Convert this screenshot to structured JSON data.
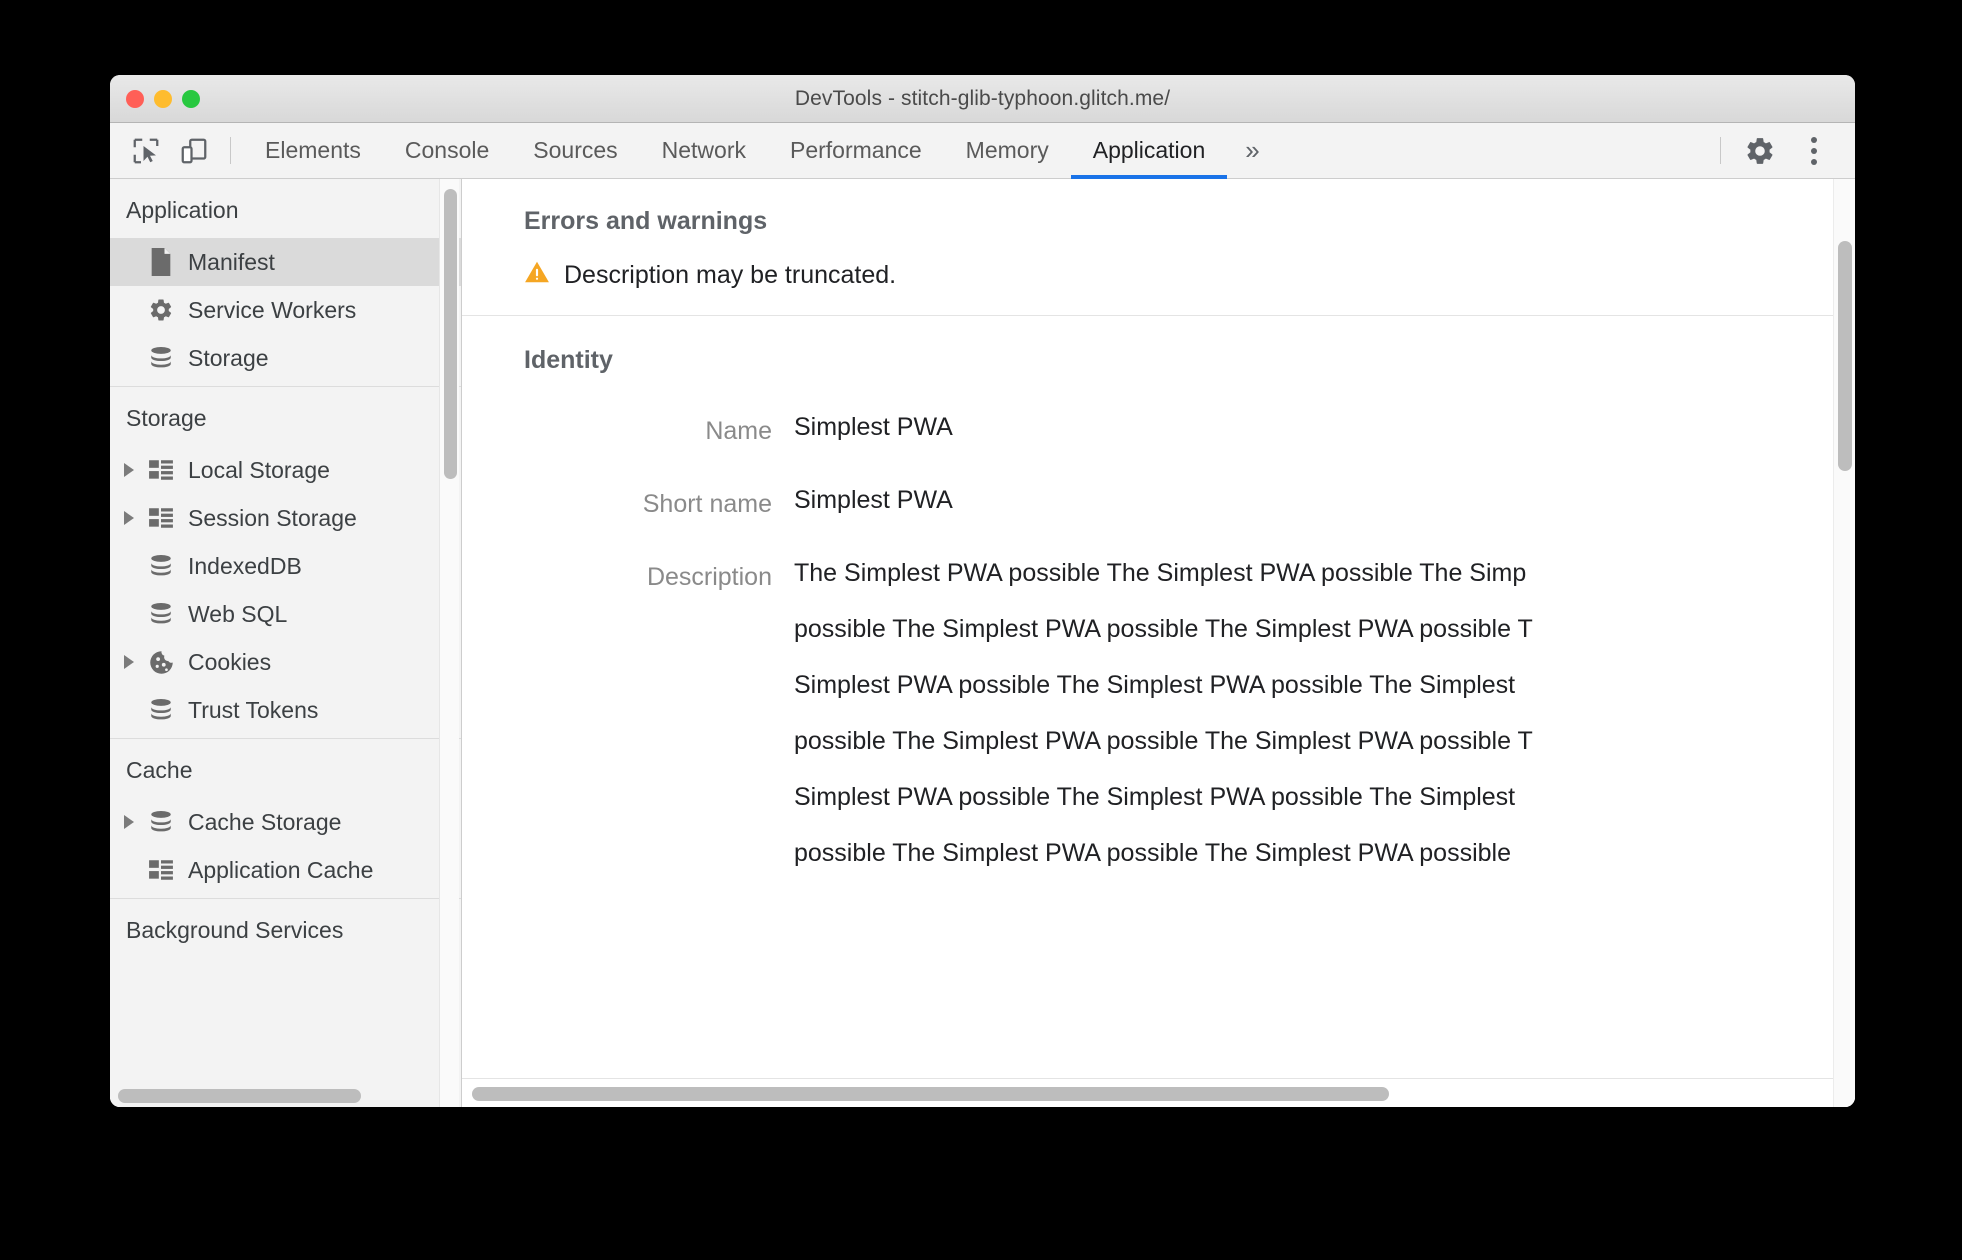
{
  "window": {
    "title": "DevTools - stitch-glib-typhoon.glitch.me/",
    "traffic_lights": [
      "close",
      "minimize",
      "zoom"
    ],
    "colors": {
      "accent": "#1a73e8",
      "warning": "#f5a623",
      "titlebar_text": "#4a4a4a",
      "selected_row": "#dadada",
      "sidebar_bg": "#f3f3f3"
    }
  },
  "toolbar": {
    "inspect_label": "inspect-element",
    "device_label": "toggle-device-toolbar",
    "more_tabs_label": "»",
    "settings_label": "settings",
    "more_options_label": "more-options"
  },
  "tabs": [
    {
      "label": "Elements",
      "active": false
    },
    {
      "label": "Console",
      "active": false
    },
    {
      "label": "Sources",
      "active": false
    },
    {
      "label": "Network",
      "active": false
    },
    {
      "label": "Performance",
      "active": false
    },
    {
      "label": "Memory",
      "active": false
    },
    {
      "label": "Application",
      "active": true
    }
  ],
  "sidebar": {
    "groups": [
      {
        "title": "Application",
        "items": [
          {
            "label": "Manifest",
            "icon": "document-icon",
            "expandable": false,
            "selected": true
          },
          {
            "label": "Service Workers",
            "icon": "gear-icon",
            "expandable": false,
            "selected": false
          },
          {
            "label": "Storage",
            "icon": "database-icon",
            "expandable": false,
            "selected": false
          }
        ]
      },
      {
        "title": "Storage",
        "items": [
          {
            "label": "Local Storage",
            "icon": "table-icon",
            "expandable": true,
            "selected": false
          },
          {
            "label": "Session Storage",
            "icon": "table-icon",
            "expandable": true,
            "selected": false
          },
          {
            "label": "IndexedDB",
            "icon": "database-icon",
            "expandable": false,
            "selected": false
          },
          {
            "label": "Web SQL",
            "icon": "database-icon",
            "expandable": false,
            "selected": false
          },
          {
            "label": "Cookies",
            "icon": "cookie-icon",
            "expandable": true,
            "selected": false
          },
          {
            "label": "Trust Tokens",
            "icon": "database-icon",
            "expandable": false,
            "selected": false
          }
        ]
      },
      {
        "title": "Cache",
        "items": [
          {
            "label": "Cache Storage",
            "icon": "database-icon",
            "expandable": true,
            "selected": false
          },
          {
            "label": "Application Cache",
            "icon": "table-icon",
            "expandable": false,
            "selected": false
          }
        ]
      },
      {
        "title": "Background Services",
        "items": []
      }
    ]
  },
  "main": {
    "errors_section": {
      "title": "Errors and warnings",
      "warning_icon": "warning-triangle-icon",
      "warning_text": "Description may be truncated."
    },
    "identity_section": {
      "title": "Identity",
      "fields": [
        {
          "label": "Name",
          "value": "Simplest PWA"
        },
        {
          "label": "Short name",
          "value": "Simplest PWA"
        }
      ],
      "description_label": "Description",
      "description_lines": [
        "The Simplest PWA possible The Simplest PWA possible The Simp",
        "possible The Simplest PWA possible The Simplest PWA possible T",
        "Simplest PWA possible The Simplest PWA possible The Simplest",
        "possible The Simplest PWA possible The Simplest PWA possible T",
        "Simplest PWA possible The Simplest PWA possible The Simplest",
        "possible The Simplest PWA possible The Simplest PWA possible"
      ]
    }
  }
}
